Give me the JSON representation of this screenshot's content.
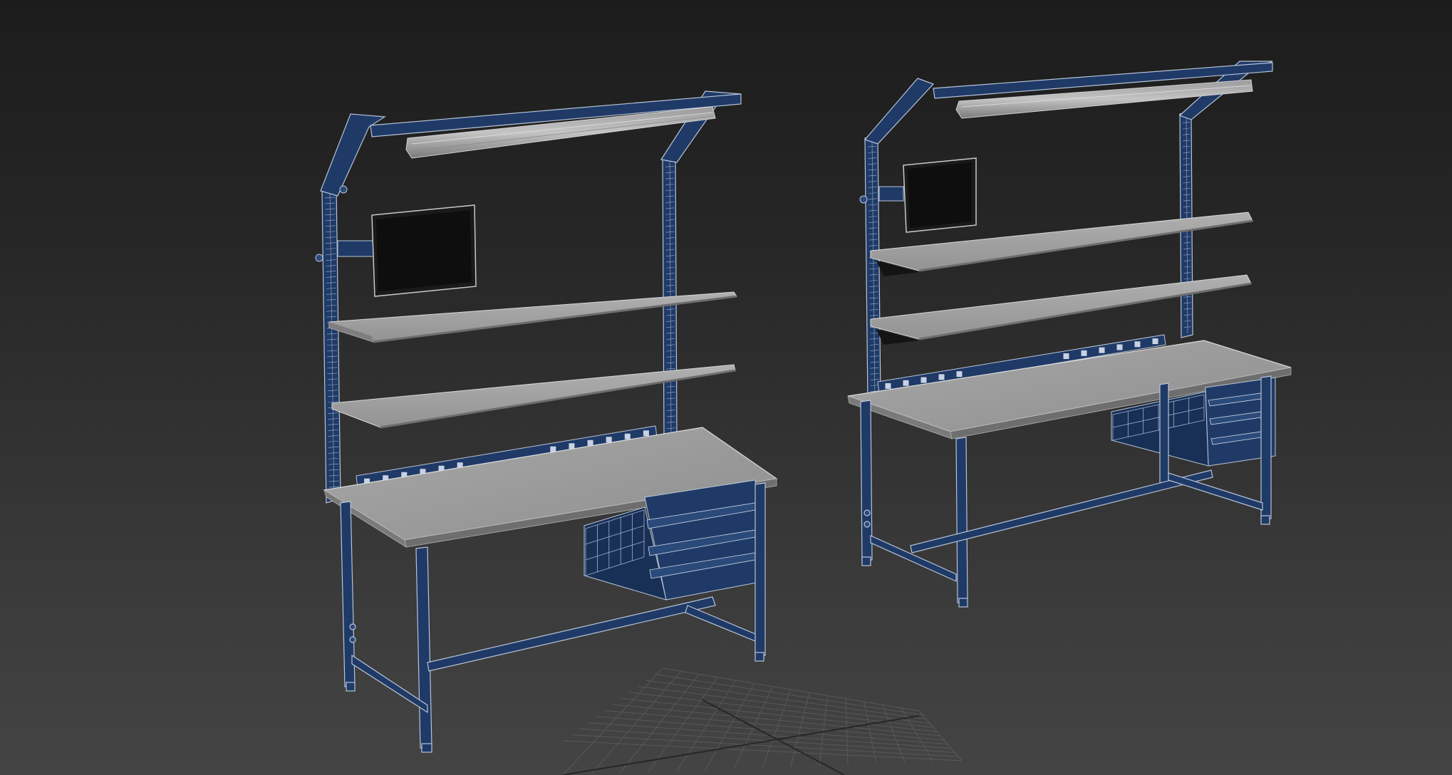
{
  "viewport": {
    "background_top": "#1c1c1c",
    "background_bottom": "#444444"
  },
  "colors": {
    "frame_blue": "#1f3a66",
    "frame_dark": "#12233f",
    "wire": "#b8c4d8",
    "surface_light": "#a2a2a2",
    "surface_edge": "#7e7e7e",
    "screen": "#0e0e0e",
    "grid": "#6a6a6a"
  },
  "objects": [
    {
      "name": "workbench-left"
    },
    {
      "name": "workbench-right"
    }
  ],
  "grid": {
    "visible": true
  }
}
